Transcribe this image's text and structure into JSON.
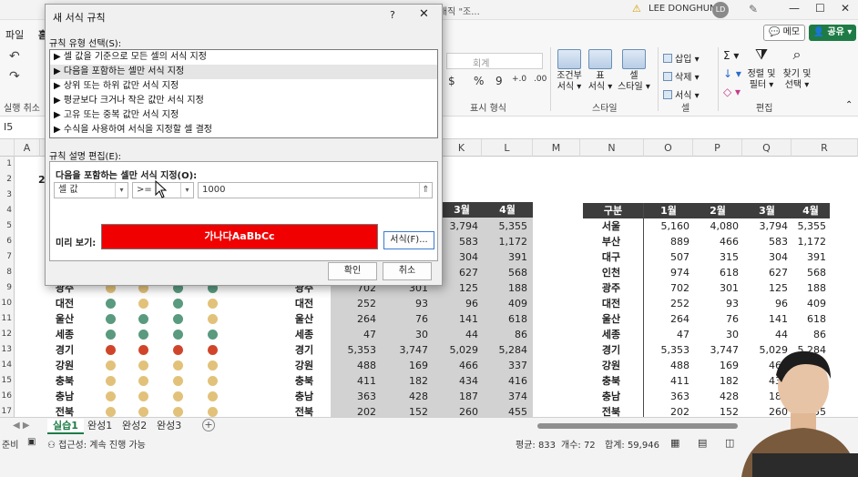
{
  "window": {
    "doc_title": "...으로 생겼다 사라지는 매직 \"조...",
    "user_name": "LEE DONGHUN",
    "user_initials": "LD",
    "min": "—",
    "max": "☐",
    "close": "✕"
  },
  "ribbon": {
    "tab_file": "파일",
    "tab_home": "홈",
    "memo": "💬 메모",
    "share": "👤 공유 ▾",
    "undo_group": "실행 취소",
    "number_format_value": "회계",
    "number_symbols": [
      "$",
      "%",
      "9",
      "+.0",
      ".00"
    ],
    "group_number": "표시 형식",
    "group_style": "스타일",
    "group_cells": "셀",
    "group_edit": "편집",
    "conditional_fmt": "조건부\n서식 ▾",
    "table_fmt": "표\n서식 ▾",
    "cell_style": "셀\n스타일 ▾",
    "insert": "삽입 ▾",
    "delete": "삭제 ▾",
    "format": "서식 ▾",
    "sum_icon": "Σ ▾",
    "fill_icon": "↓ ▾",
    "clear_icon": "◇ ▾",
    "sort_filter": "정렬 및\n필터 ▾",
    "find_select": "찾기 및\n선택 ▾"
  },
  "formula_bar": {
    "name_box": "I5"
  },
  "columns": [
    "A",
    "K",
    "L",
    "M",
    "N",
    "O",
    "P",
    "Q",
    "R"
  ],
  "row_numbers": [
    "1",
    "2",
    "3",
    "4",
    "5",
    "6",
    "7",
    "8",
    "9",
    "10",
    "11",
    "12",
    "13",
    "14",
    "15",
    "16",
    "17"
  ],
  "left_header_fragment": "2",
  "left_table": {
    "regions": [
      "광주",
      "대전",
      "울산",
      "세종",
      "경기",
      "강원",
      "충북",
      "충남",
      "전북"
    ],
    "dots": [
      [
        "y",
        "y",
        "g",
        "g"
      ],
      [
        "g",
        "y",
        "g",
        "y"
      ],
      [
        "g",
        "g",
        "g",
        "y"
      ],
      [
        "g",
        "g",
        "g",
        "g"
      ],
      [
        "r",
        "r",
        "r",
        "r"
      ],
      [
        "y",
        "y",
        "y",
        "y"
      ],
      [
        "y",
        "y",
        "y",
        "y"
      ],
      [
        "y",
        "y",
        "y",
        "y"
      ],
      [
        "y",
        "y",
        "y",
        "y"
      ]
    ]
  },
  "mid_table": {
    "headers": [
      "3월",
      "4월"
    ],
    "regions": [
      "광주",
      "대전",
      "울산",
      "세종",
      "경기",
      "강원",
      "충북",
      "충남",
      "전북"
    ],
    "visible_top_rows": [
      [
        "3,794",
        "5,355"
      ],
      [
        "583",
        "1,172"
      ],
      [
        "304",
        "391"
      ],
      [
        "627",
        "568"
      ]
    ],
    "rows": [
      [
        "702",
        "301",
        "125",
        "188"
      ],
      [
        "252",
        "93",
        "96",
        "409"
      ],
      [
        "264",
        "76",
        "141",
        "618"
      ],
      [
        "47",
        "30",
        "44",
        "86"
      ],
      [
        "5,353",
        "3,747",
        "5,029",
        "5,284"
      ],
      [
        "488",
        "169",
        "466",
        "337"
      ],
      [
        "411",
        "182",
        "434",
        "416"
      ],
      [
        "363",
        "428",
        "187",
        "374"
      ],
      [
        "202",
        "152",
        "260",
        "455"
      ]
    ]
  },
  "right_table": {
    "headers": [
      "구분",
      "1월",
      "2월",
      "3월",
      "4월"
    ],
    "rows": [
      [
        "서울",
        "5,160",
        "4,080",
        "3,794",
        "5,355"
      ],
      [
        "부산",
        "889",
        "466",
        "583",
        "1,172"
      ],
      [
        "대구",
        "507",
        "315",
        "304",
        "391"
      ],
      [
        "인천",
        "974",
        "618",
        "627",
        "568"
      ],
      [
        "광주",
        "702",
        "301",
        "125",
        "188"
      ],
      [
        "대전",
        "252",
        "93",
        "96",
        "409"
      ],
      [
        "울산",
        "264",
        "76",
        "141",
        "618"
      ],
      [
        "세종",
        "47",
        "30",
        "44",
        "86"
      ],
      [
        "경기",
        "5,353",
        "3,747",
        "5,029",
        "5,284"
      ],
      [
        "강원",
        "488",
        "169",
        "466",
        "337"
      ],
      [
        "충북",
        "411",
        "182",
        "434",
        "416"
      ],
      [
        "충남",
        "363",
        "428",
        "187",
        "474"
      ],
      [
        "전북",
        "202",
        "152",
        "260",
        "455"
      ]
    ]
  },
  "sheet_tabs": [
    "실습1",
    "완성1",
    "완성2",
    "완성3"
  ],
  "sheet_add": "+",
  "status": {
    "ready": "준비",
    "accessibility": "접근성: 계속 진행 가능",
    "average": "평균: 833",
    "count": "개수: 72",
    "sum_label": "합계: 59,946"
  },
  "dialog": {
    "title": "새 서식 규칙",
    "help": "?",
    "close": "✕",
    "rule_type_label": "규칙 유형 선택(S):",
    "rule_types": [
      "▶ 셀 값을 기준으로 모든 셀의 서식 지정",
      "▶ 다음을 포함하는 셀만 서식 지정",
      "▶ 상위 또는 하위 값만 서식 지정",
      "▶ 평균보다 크거나 작은 값만 서식 지정",
      "▶ 고유 또는 중복 값만 서식 지정",
      "▶ 수식을 사용하여 서식을 지정할 셀 결정"
    ],
    "selected_index": 1,
    "desc_label": "규칙 설명 편집(E):",
    "desc_title": "다음을 포함하는 셀만 서식 지정(O):",
    "cond_field": "셀 값",
    "cond_op": ">=",
    "cond_value": "1000",
    "preview_label": "미리 보기:",
    "preview_text": "가나다AaBbCc",
    "preview_bg": "#f00000",
    "format_button": "서식(F)...",
    "ok": "확인",
    "cancel": "취소"
  }
}
